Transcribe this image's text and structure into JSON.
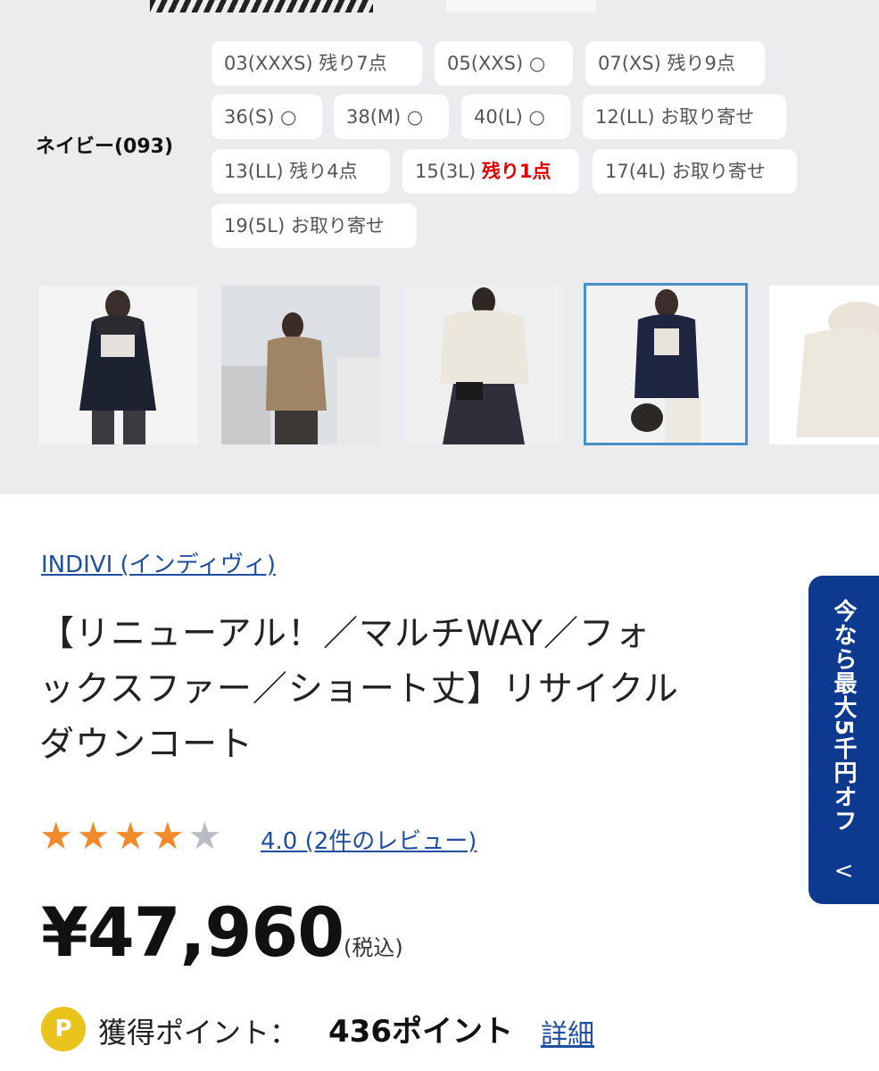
{
  "color_option": {
    "label": "ネイビー(093)"
  },
  "sizes": [
    {
      "code": "03(XXXS)",
      "stock": "残り7点",
      "hot": ""
    },
    {
      "code": "05(XXS)",
      "stock": "○",
      "hot": ""
    },
    {
      "code": "07(XS)",
      "stock": "残り9点",
      "hot": ""
    },
    {
      "code": "36(S)",
      "stock": "○",
      "hot": ""
    },
    {
      "code": "38(M)",
      "stock": "○",
      "hot": ""
    },
    {
      "code": "40(L)",
      "stock": "○",
      "hot": ""
    },
    {
      "code": "12(LL)",
      "stock": "お取り寄せ",
      "hot": ""
    },
    {
      "code": "13(LL)",
      "stock": "残り4点",
      "hot": ""
    },
    {
      "code": "15(3L)",
      "stock": "",
      "hot": "残り1点"
    },
    {
      "code": "17(4L)",
      "stock": "お取り寄せ",
      "hot": ""
    },
    {
      "code": "19(5L)",
      "stock": "お取り寄せ",
      "hot": ""
    }
  ],
  "thumbnails": [
    {
      "selected": false
    },
    {
      "selected": false
    },
    {
      "selected": false
    },
    {
      "selected": true
    },
    {
      "selected": false
    }
  ],
  "product": {
    "brand": "INDIVI (インディヴィ)",
    "title_line1": "【リニューアル！／マルチWAY／フォ",
    "title_line2": "ックスファー／ショート丈】リサイクル",
    "title_line3": "ダウンコート",
    "rating": {
      "stars_filled": 4,
      "stars_total": 5,
      "text": "4.0 (2件のレビュー)"
    },
    "price": "¥47,960",
    "tax_note": "(税込)",
    "points": {
      "badge": "P",
      "label": "獲得ポイント：",
      "value": "436ポイント",
      "detail": "詳細"
    }
  },
  "side_banner": {
    "text": "今なら最大5千円オフ",
    "chevron": "<"
  },
  "colors": {
    "accent_link": "#1f4fa0",
    "star": "#f08a2c",
    "banner": "#0d3a8e",
    "hot": "#e00000"
  }
}
